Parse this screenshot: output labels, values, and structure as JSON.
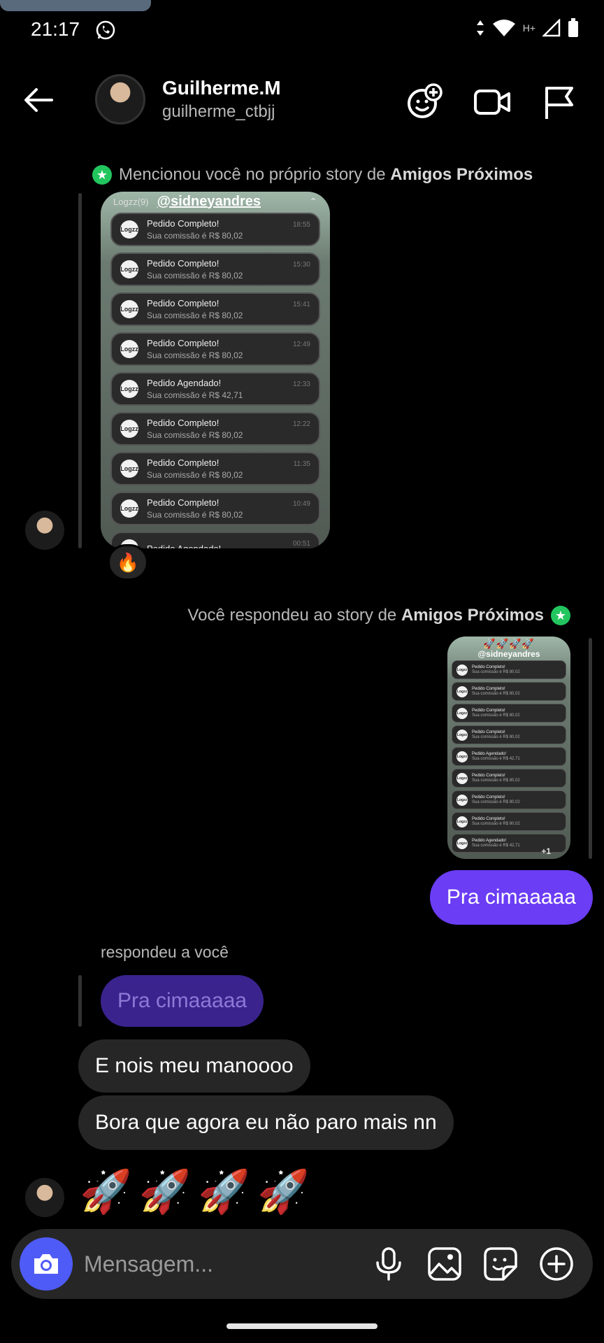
{
  "status_bar": {
    "time": "21:17",
    "network_label": "H+"
  },
  "header": {
    "name": "Guilherme.M",
    "username": "guilherme_ctbjj",
    "icons": [
      "back-arrow-icon",
      "add-effect-icon",
      "video-call-icon",
      "flag-icon"
    ]
  },
  "thread": {
    "mention_notice": {
      "prefix": "Mencionou você no próprio story de",
      "bold": "Amigos Próximos"
    },
    "story_in": {
      "app_label": "Logzz(9)",
      "mention": "@sidneyandres",
      "logo_text": "Logzz",
      "notifications": [
        {
          "title": "Pedido Completo!",
          "body": "Sua comissão é R$ 80,02",
          "time": "18:55"
        },
        {
          "title": "Pedido Completo!",
          "body": "Sua comissão é R$ 80,02",
          "time": "15:30"
        },
        {
          "title": "Pedido Completo!",
          "body": "Sua comissão é R$ 80,02",
          "time": "15:41"
        },
        {
          "title": "Pedido Completo!",
          "body": "Sua comissão é R$ 80,02",
          "time": "12:49"
        },
        {
          "title": "Pedido Agendado!",
          "body": "Sua comissão é R$ 42,71",
          "time": "12:33"
        },
        {
          "title": "Pedido Completo!",
          "body": "Sua comissão é R$ 80,02",
          "time": "12:22"
        },
        {
          "title": "Pedido Completo!",
          "body": "Sua comissão é R$ 80,02",
          "time": "11:35"
        },
        {
          "title": "Pedido Completo!",
          "body": "Sua comissão é R$ 80,02",
          "time": "10:49"
        },
        {
          "title": "Pedido Agendado!",
          "body": "",
          "time": "00:51"
        }
      ]
    },
    "reaction": "🔥",
    "reply_notice": {
      "prefix": "Você respondeu ao story de",
      "bold": "Amigos Próximos"
    },
    "story_out": {
      "rockets": "🚀🚀🚀🚀",
      "mention": "@sidneyandres",
      "more_badge": "+1",
      "logo_text": "Logzz",
      "notifications": [
        {
          "title": "Pedido Completo!",
          "body": "Sua comissão é R$ 80,02"
        },
        {
          "title": "Pedido Completo!",
          "body": "Sua comissão é R$ 80,02"
        },
        {
          "title": "Pedido Completo!",
          "body": "Sua comissão é R$ 80,02"
        },
        {
          "title": "Pedido Completo!",
          "body": "Sua comissão é R$ 80,02"
        },
        {
          "title": "Pedido Agendado!",
          "body": "Sua comissão é R$ 42,71"
        },
        {
          "title": "Pedido Completo!",
          "body": "Sua comissão é R$ 80,02"
        },
        {
          "title": "Pedido Completo!",
          "body": "Sua comissão é R$ 80,02"
        },
        {
          "title": "Pedido Completo!",
          "body": "Sua comissão é R$ 80,02"
        },
        {
          "title": "Pedido Agendado!",
          "body": "Sua comissão é R$ 42,71"
        }
      ]
    },
    "outgoing_message": "Pra cimaaaaa",
    "replied_label": "respondeu a você",
    "quoted_message": "Pra cimaaaaa",
    "incoming_messages": [
      "E nois meu manoooo",
      "Bora que agora eu não paro mais nn"
    ],
    "emoji_message": "🚀🚀🚀🚀"
  },
  "composer": {
    "placeholder": "Mensagem...",
    "icons": [
      "camera-icon",
      "microphone-icon",
      "gallery-icon",
      "sticker-icon",
      "plus-icon"
    ]
  },
  "colors": {
    "outgoing_bubble": "#6b3df5",
    "incoming_bubble": "#262626",
    "camera_button": "#4f5bf7",
    "close_friends_green": "#22c55e"
  }
}
